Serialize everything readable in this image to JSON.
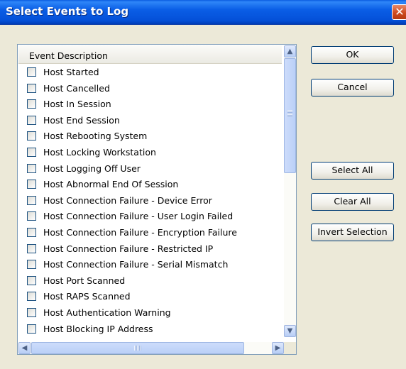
{
  "window": {
    "title": "Select Events to Log",
    "close_glyph": "✕"
  },
  "list": {
    "header": "Event Description",
    "items": [
      "Host Started",
      "Host Cancelled",
      "Host In Session",
      "Host End Session",
      "Host Rebooting System",
      "Host Locking Workstation",
      "Host Logging Off User",
      "Host Abnormal End Of Session",
      "Host Connection Failure - Device Error",
      "Host Connection Failure - User Login Failed",
      "Host Connection Failure - Encryption Failure",
      "Host Connection Failure - Restricted IP",
      "Host Connection Failure - Serial Mismatch",
      "Host Port Scanned",
      "Host RAPS Scanned",
      "Host Authentication Warning",
      "Host Blocking IP Address"
    ],
    "checked": [
      false,
      false,
      false,
      false,
      false,
      false,
      false,
      false,
      false,
      false,
      false,
      false,
      false,
      false,
      false,
      false,
      false
    ]
  },
  "scroll": {
    "up": "▲",
    "down": "▼",
    "left": "◀",
    "right": "▶"
  },
  "buttons": {
    "ok": "OK",
    "cancel": "Cancel",
    "select_all": "Select All",
    "clear_all": "Clear All",
    "invert_selection": "Invert Selection"
  }
}
